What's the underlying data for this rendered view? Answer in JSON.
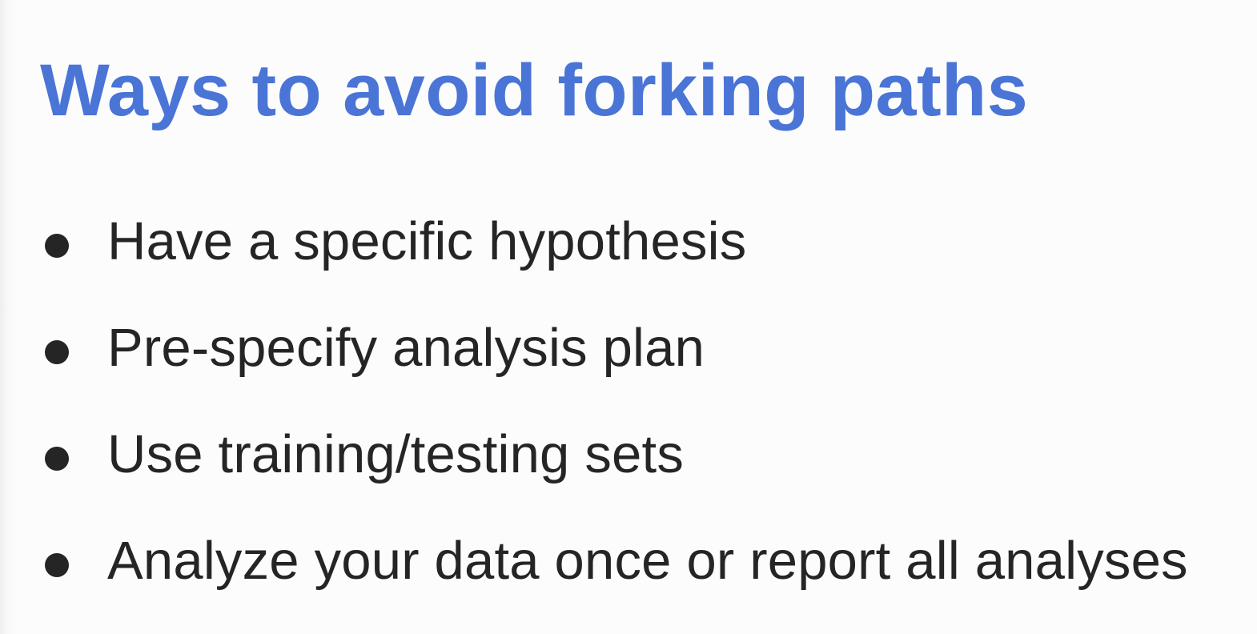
{
  "slide": {
    "title": "Ways to avoid forking paths",
    "bullets": [
      "Have a specific hypothesis",
      "Pre-specify analysis plan",
      "Use training/testing sets",
      "Analyze your data once or report all analyses"
    ]
  },
  "colors": {
    "title": "#4a74d6",
    "text": "#252525",
    "background": "#fcfcfc"
  }
}
